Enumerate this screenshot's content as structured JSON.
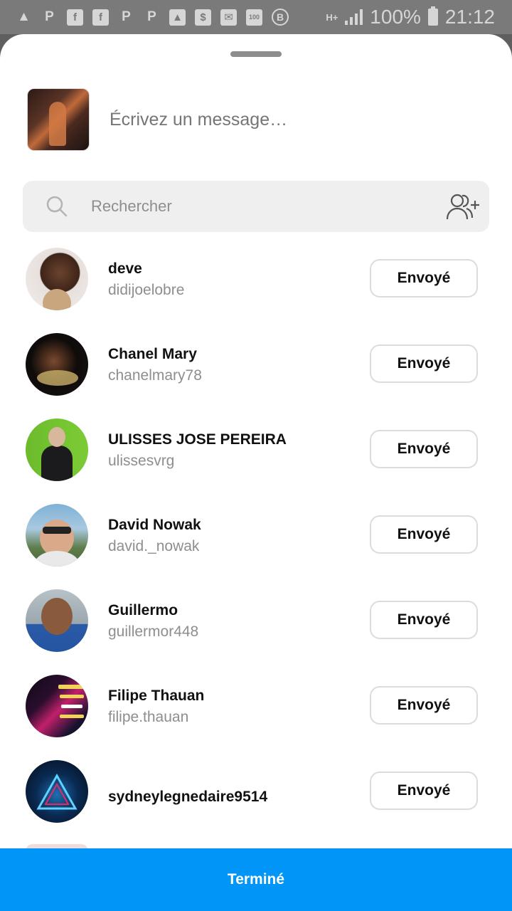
{
  "status_bar": {
    "left_icons": [
      "message-bubble-icon",
      "p-icon",
      "facebook-icon",
      "facebook-icon",
      "p-icon",
      "p-icon",
      "image-icon",
      "money-icon",
      "mail-icon",
      "storage-100-icon",
      "b-icon"
    ],
    "network": "H+",
    "battery": "100%",
    "time": "21:12"
  },
  "share_sheet": {
    "message_placeholder": "Écrivez un message…",
    "search_placeholder": "Rechercher",
    "recipients": [
      {
        "name": "deve",
        "username": "didijoelobre",
        "button": "Envoyé"
      },
      {
        "name": "Chanel Mary",
        "username": "chanelmary78",
        "button": "Envoyé"
      },
      {
        "name": "ULISSES JOSE PEREIRA",
        "username": "ulissesvrg",
        "button": "Envoyé"
      },
      {
        "name": "David Nowak",
        "username": "david._nowak",
        "button": "Envoyé"
      },
      {
        "name": "Guillermo",
        "username": "guillermor448",
        "button": "Envoyé"
      },
      {
        "name": "Filipe Thauan",
        "username": "filipe.thauan",
        "button": "Envoyé"
      },
      {
        "name": "sydneylegnedaire9514",
        "username": "",
        "button": "Envoyé"
      }
    ],
    "done_label": "Terminé"
  },
  "colors": {
    "primary_button": "#0095f6",
    "search_bg": "#efefef",
    "secondary_text": "#8e8e8e"
  }
}
